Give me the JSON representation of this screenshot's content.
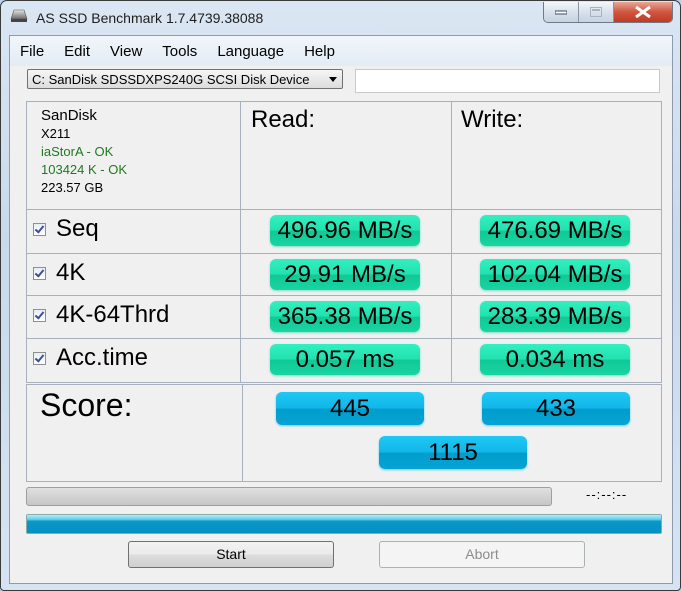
{
  "window": {
    "title": "AS SSD Benchmark 1.7.4739.38088",
    "icon": "drive-icon",
    "controls": [
      "minimize",
      "maximize",
      "close"
    ]
  },
  "menu": {
    "items": [
      "File",
      "Edit",
      "View",
      "Tools",
      "Language",
      "Help"
    ]
  },
  "drive_select": {
    "value": "C: SanDisk SDSSDXPS240G SCSI Disk Device"
  },
  "text_field": {
    "value": ""
  },
  "info": {
    "vendor": "SanDisk",
    "firmware": "X211",
    "driver_status": "iaStorA - OK",
    "alignment_status": "103424 K - OK",
    "capacity": "223.57 GB",
    "ok_color": "#1f7a1f"
  },
  "columns": {
    "read": "Read:",
    "write": "Write:"
  },
  "rows": [
    {
      "label": "Seq",
      "checked": true,
      "read": "496.96 MB/s",
      "write": "476.69 MB/s"
    },
    {
      "label": "4K",
      "checked": true,
      "read": "29.91 MB/s",
      "write": "102.04 MB/s"
    },
    {
      "label": "4K-64Thrd",
      "checked": true,
      "read": "365.38 MB/s",
      "write": "283.39 MB/s"
    },
    {
      "label": "Acc.time",
      "checked": true,
      "read": "0.057 ms",
      "write": "0.034 ms"
    }
  ],
  "score": {
    "label": "Score:",
    "read": "445",
    "write": "433",
    "total": "1115"
  },
  "progress": {
    "test_progress": 0,
    "timer": "--:--:--",
    "overall_progress": 1.0
  },
  "buttons": {
    "start": "Start",
    "abort": "Abort"
  },
  "colors": {
    "result_pill": "#22e0b0",
    "score_pill": "#10b6e8",
    "progress_fill": "#0898c8"
  }
}
